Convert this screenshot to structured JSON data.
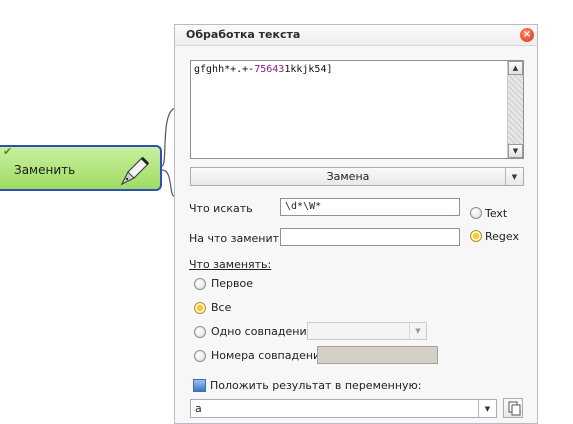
{
  "node": {
    "label": "Заменить"
  },
  "dialog": {
    "title": "Обработка текста",
    "editor": {
      "prefix": "gfghh*+.+-",
      "number": "75643",
      "suffix": "1kkjk54]"
    },
    "operation": "Замена",
    "find_label": "Что искать",
    "find_value": "\\d*\\W*",
    "replace_label": "На что заменить",
    "replace_value": "",
    "mode_options": [
      "Text",
      "Regex"
    ],
    "mode_selected": "Regex",
    "what_replace_label": "Что заменять:",
    "what_options": [
      "Первое",
      "Все",
      "Одно совпадение",
      "Номера совпадений"
    ],
    "what_selected": "Все",
    "save_label": "Положить результат в переменную:",
    "save_variable": "a"
  },
  "colors": {
    "node_fill": "#b4e682",
    "node_border": "#2f4fb8",
    "radio_selected": "#ffc83a"
  }
}
